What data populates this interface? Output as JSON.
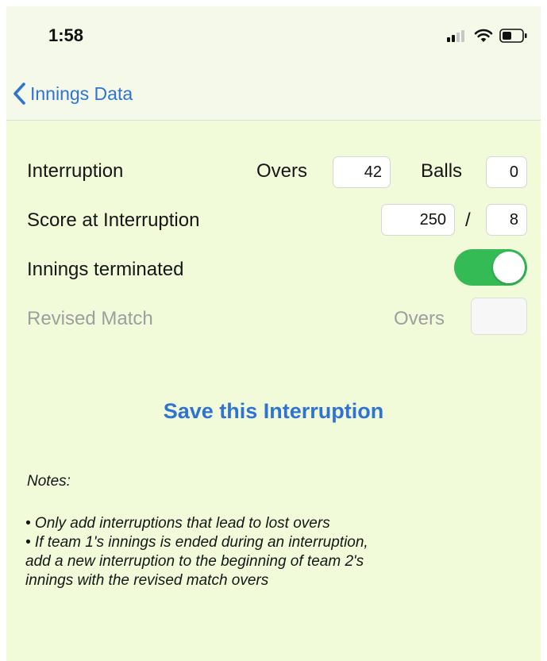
{
  "status_bar": {
    "time": "1:58"
  },
  "nav": {
    "back_label": "Innings Data"
  },
  "interruption": {
    "label": "Interruption",
    "overs_label": "Overs",
    "overs_value": "42",
    "balls_label": "Balls",
    "balls_value": "0"
  },
  "score": {
    "label": "Score at Interruption",
    "runs_value": "250",
    "separator": "/",
    "wickets_value": "8"
  },
  "terminated": {
    "label": "Innings terminated",
    "toggle_on": true
  },
  "revised": {
    "label": "Revised Match",
    "overs_label": "Overs",
    "overs_value": ""
  },
  "save_label": "Save this Interruption",
  "notes": {
    "title": "Notes:",
    "lines": [
      "• Only add interruptions that lead to lost overs",
      "• If team 1's innings is ended during an interruption,",
      "add a new interruption to the beginning of team 2's",
      "innings with the revised match overs"
    ]
  },
  "colors": {
    "accent": "#2f74d3",
    "toggle_on": "#35bb56",
    "background": "#f1fbd9"
  }
}
